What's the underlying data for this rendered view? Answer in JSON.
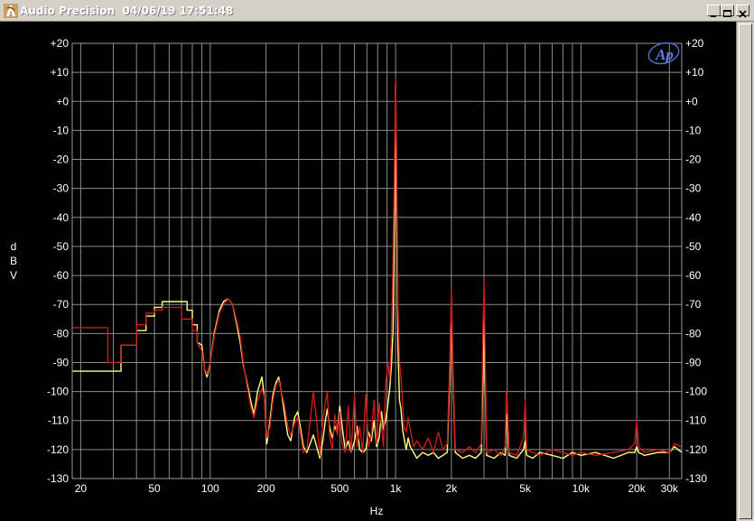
{
  "window": {
    "title": "Audio Precision  04/06/19 17:51:48",
    "icons": {
      "app": "audio-precision-icon",
      "minimize": "minimize-icon",
      "maximize": "maximize-icon",
      "close": "close-icon"
    }
  },
  "chart_data": {
    "type": "line",
    "xlabel": "Hz",
    "ylabel": "dBV",
    "xscale": "log",
    "xlim": [
      18,
      35000
    ],
    "ylim": [
      -130,
      20
    ],
    "grid": true,
    "logo_text": "Ap",
    "x_ticks": [
      {
        "v": 20,
        "label": "20"
      },
      {
        "v": 50,
        "label": "50"
      },
      {
        "v": 100,
        "label": "100"
      },
      {
        "v": 200,
        "label": "200"
      },
      {
        "v": 500,
        "label": "500"
      },
      {
        "v": 1000,
        "label": "1k"
      },
      {
        "v": 2000,
        "label": "2k"
      },
      {
        "v": 5000,
        "label": "5k"
      },
      {
        "v": 10000,
        "label": "10k"
      },
      {
        "v": 20000,
        "label": "20k"
      },
      {
        "v": 30000,
        "label": "30k"
      }
    ],
    "y_ticks": [
      {
        "v": 20,
        "label": "+20"
      },
      {
        "v": 10,
        "label": "+10"
      },
      {
        "v": 0,
        "label": "+0"
      },
      {
        "v": -10,
        "label": "-10"
      },
      {
        "v": -20,
        "label": "-20"
      },
      {
        "v": -30,
        "label": "-30"
      },
      {
        "v": -40,
        "label": "-40"
      },
      {
        "v": -50,
        "label": "-50"
      },
      {
        "v": -60,
        "label": "-60"
      },
      {
        "v": -70,
        "label": "-70"
      },
      {
        "v": -80,
        "label": "-80"
      },
      {
        "v": -90,
        "label": "-90"
      },
      {
        "v": -100,
        "label": "-100"
      },
      {
        "v": -110,
        "label": "-110"
      },
      {
        "v": -120,
        "label": "-120"
      },
      {
        "v": -130,
        "label": "-130"
      }
    ],
    "series": [
      {
        "color": "#ffff80",
        "points": [
          [
            18,
            -93
          ],
          [
            20,
            -93
          ],
          [
            25,
            -93
          ],
          [
            30,
            -93
          ],
          [
            33,
            -93
          ],
          [
            33,
            -84
          ],
          [
            40,
            -84
          ],
          [
            40,
            -79
          ],
          [
            45,
            -79
          ],
          [
            45,
            -74
          ],
          [
            50,
            -74
          ],
          [
            50,
            -71
          ],
          [
            55,
            -71
          ],
          [
            55,
            -69
          ],
          [
            60,
            -69
          ],
          [
            70,
            -69
          ],
          [
            75,
            -69
          ],
          [
            75,
            -72
          ],
          [
            80,
            -72
          ],
          [
            80,
            -77
          ],
          [
            85,
            -77
          ],
          [
            85,
            -83
          ],
          [
            90,
            -84
          ],
          [
            93,
            -92
          ],
          [
            96,
            -95
          ],
          [
            100,
            -90
          ],
          [
            105,
            -80
          ],
          [
            112,
            -72
          ],
          [
            118,
            -69
          ],
          [
            125,
            -68
          ],
          [
            132,
            -70
          ],
          [
            138,
            -76
          ],
          [
            145,
            -83
          ],
          [
            150,
            -90
          ],
          [
            158,
            -97
          ],
          [
            165,
            -103
          ],
          [
            172,
            -108
          ],
          [
            180,
            -100
          ],
          [
            190,
            -95
          ],
          [
            196,
            -102
          ],
          [
            202,
            -118
          ],
          [
            210,
            -110
          ],
          [
            218,
            -101
          ],
          [
            226,
            -97
          ],
          [
            234,
            -95
          ],
          [
            242,
            -100
          ],
          [
            252,
            -108
          ],
          [
            262,
            -115
          ],
          [
            272,
            -117
          ],
          [
            285,
            -109
          ],
          [
            296,
            -107
          ],
          [
            306,
            -112
          ],
          [
            318,
            -119
          ],
          [
            332,
            -121
          ],
          [
            346,
            -118
          ],
          [
            360,
            -115
          ],
          [
            375,
            -119
          ],
          [
            390,
            -123
          ],
          [
            405,
            -117
          ],
          [
            418,
            -110
          ],
          [
            428,
            -106
          ],
          [
            440,
            -112
          ],
          [
            455,
            -116
          ],
          [
            470,
            -112
          ],
          [
            485,
            -114
          ],
          [
            500,
            -105
          ],
          [
            515,
            -112
          ],
          [
            535,
            -120
          ],
          [
            555,
            -117
          ],
          [
            575,
            -121
          ],
          [
            600,
            -117
          ],
          [
            620,
            -112
          ],
          [
            640,
            -120
          ],
          [
            665,
            -121
          ],
          [
            690,
            -120
          ],
          [
            715,
            -114
          ],
          [
            740,
            -117
          ],
          [
            765,
            -110
          ],
          [
            790,
            -119
          ],
          [
            815,
            -116
          ],
          [
            840,
            -107
          ],
          [
            860,
            -113
          ],
          [
            885,
            -110
          ],
          [
            910,
            -104
          ],
          [
            930,
            -99
          ],
          [
            950,
            -91
          ],
          [
            970,
            -78
          ],
          [
            985,
            -40
          ],
          [
            1000,
            6
          ],
          [
            1015,
            -40
          ],
          [
            1030,
            -85
          ],
          [
            1050,
            -103
          ],
          [
            1070,
            -106
          ],
          [
            1090,
            -113
          ],
          [
            1110,
            -116
          ],
          [
            1140,
            -120
          ],
          [
            1170,
            -116
          ],
          [
            1200,
            -119
          ],
          [
            1250,
            -121
          ],
          [
            1300,
            -123
          ],
          [
            1400,
            -121
          ],
          [
            1500,
            -122
          ],
          [
            1600,
            -121
          ],
          [
            1700,
            -123
          ],
          [
            1800,
            -122
          ],
          [
            1900,
            -121
          ],
          [
            1960,
            -95
          ],
          [
            2000,
            -68
          ],
          [
            2040,
            -95
          ],
          [
            2100,
            -121
          ],
          [
            2300,
            -123
          ],
          [
            2500,
            -122
          ],
          [
            2700,
            -123
          ],
          [
            2900,
            -121
          ],
          [
            2960,
            -95
          ],
          [
            3000,
            -75
          ],
          [
            3040,
            -95
          ],
          [
            3100,
            -122
          ],
          [
            3400,
            -123
          ],
          [
            3700,
            -121
          ],
          [
            3900,
            -122
          ],
          [
            3960,
            -108
          ],
          [
            4000,
            -108
          ],
          [
            4040,
            -115
          ],
          [
            4100,
            -122
          ],
          [
            4500,
            -123
          ],
          [
            4900,
            -120
          ],
          [
            5000,
            -117
          ],
          [
            5100,
            -122
          ],
          [
            5500,
            -123
          ],
          [
            6000,
            -121
          ],
          [
            7000,
            -122
          ],
          [
            8000,
            -123
          ],
          [
            9000,
            -121
          ],
          [
            10000,
            -122
          ],
          [
            12000,
            -121
          ],
          [
            15000,
            -123
          ],
          [
            18000,
            -121
          ],
          [
            19500,
            -121
          ],
          [
            20000,
            -119
          ],
          [
            20500,
            -121
          ],
          [
            22000,
            -122
          ],
          [
            26000,
            -121
          ],
          [
            30000,
            -121
          ],
          [
            32000,
            -119
          ],
          [
            35000,
            -121
          ]
        ]
      },
      {
        "color": "#cc1a1a",
        "points": [
          [
            18,
            -78
          ],
          [
            20,
            -78
          ],
          [
            25,
            -78
          ],
          [
            28,
            -78
          ],
          [
            28,
            -90
          ],
          [
            33,
            -90
          ],
          [
            33,
            -84
          ],
          [
            40,
            -84
          ],
          [
            40,
            -77
          ],
          [
            45,
            -77
          ],
          [
            45,
            -73
          ],
          [
            50,
            -73
          ],
          [
            50,
            -72
          ],
          [
            55,
            -72
          ],
          [
            55,
            -71
          ],
          [
            60,
            -71
          ],
          [
            70,
            -71
          ],
          [
            70,
            -75
          ],
          [
            80,
            -75
          ],
          [
            80,
            -79
          ],
          [
            85,
            -79
          ],
          [
            85,
            -83
          ],
          [
            90,
            -86
          ],
          [
            93,
            -92
          ],
          [
            96,
            -94
          ],
          [
            100,
            -90
          ],
          [
            105,
            -81
          ],
          [
            112,
            -73
          ],
          [
            118,
            -70
          ],
          [
            125,
            -68
          ],
          [
            132,
            -70
          ],
          [
            138,
            -75
          ],
          [
            145,
            -81
          ],
          [
            150,
            -89
          ],
          [
            158,
            -98
          ],
          [
            165,
            -105
          ],
          [
            172,
            -109
          ],
          [
            180,
            -103
          ],
          [
            190,
            -99
          ],
          [
            196,
            -102
          ],
          [
            202,
            -116
          ],
          [
            210,
            -112
          ],
          [
            218,
            -103
          ],
          [
            226,
            -98
          ],
          [
            234,
            -96
          ],
          [
            242,
            -100
          ],
          [
            252,
            -105
          ],
          [
            262,
            -112
          ],
          [
            272,
            -115
          ],
          [
            285,
            -111
          ],
          [
            296,
            -109
          ],
          [
            306,
            -114
          ],
          [
            318,
            -121
          ],
          [
            332,
            -120
          ],
          [
            346,
            -110
          ],
          [
            360,
            -100
          ],
          [
            375,
            -110
          ],
          [
            390,
            -122
          ],
          [
            405,
            -110
          ],
          [
            418,
            -104
          ],
          [
            428,
            -100
          ],
          [
            440,
            -115
          ],
          [
            455,
            -120
          ],
          [
            470,
            -108
          ],
          [
            485,
            -115
          ],
          [
            500,
            -107
          ],
          [
            515,
            -118
          ],
          [
            535,
            -121
          ],
          [
            555,
            -105
          ],
          [
            575,
            -121
          ],
          [
            600,
            -101
          ],
          [
            620,
            -119
          ],
          [
            640,
            -112
          ],
          [
            665,
            -121
          ],
          [
            690,
            -101
          ],
          [
            715,
            -119
          ],
          [
            740,
            -115
          ],
          [
            765,
            -103
          ],
          [
            790,
            -118
          ],
          [
            815,
            -104
          ],
          [
            840,
            -112
          ],
          [
            860,
            -119
          ],
          [
            885,
            -97
          ],
          [
            910,
            -90
          ],
          [
            930,
            -96
          ],
          [
            950,
            -80
          ],
          [
            965,
            -60
          ],
          [
            985,
            -25
          ],
          [
            1000,
            8
          ],
          [
            1015,
            -25
          ],
          [
            1030,
            -70
          ],
          [
            1050,
            -90
          ],
          [
            1070,
            -95
          ],
          [
            1090,
            -104
          ],
          [
            1110,
            -112
          ],
          [
            1140,
            -114
          ],
          [
            1170,
            -109
          ],
          [
            1200,
            -113
          ],
          [
            1250,
            -119
          ],
          [
            1300,
            -117
          ],
          [
            1400,
            -120
          ],
          [
            1500,
            -116
          ],
          [
            1600,
            -121
          ],
          [
            1700,
            -114
          ],
          [
            1800,
            -120
          ],
          [
            1900,
            -118
          ],
          [
            1960,
            -90
          ],
          [
            2000,
            -65
          ],
          [
            2040,
            -92
          ],
          [
            2100,
            -120
          ],
          [
            2300,
            -121
          ],
          [
            2500,
            -119
          ],
          [
            2700,
            -121
          ],
          [
            2900,
            -118
          ],
          [
            2960,
            -80
          ],
          [
            3000,
            -62
          ],
          [
            3040,
            -85
          ],
          [
            3100,
            -121
          ],
          [
            3400,
            -120
          ],
          [
            3700,
            -122
          ],
          [
            3900,
            -119
          ],
          [
            3960,
            -100
          ],
          [
            4000,
            -103
          ],
          [
            4040,
            -110
          ],
          [
            4100,
            -121
          ],
          [
            4500,
            -122
          ],
          [
            4900,
            -116
          ],
          [
            5000,
            -103
          ],
          [
            5100,
            -120
          ],
          [
            5500,
            -121
          ],
          [
            6000,
            -122
          ],
          [
            7000,
            -120
          ],
          [
            8000,
            -121
          ],
          [
            9000,
            -122
          ],
          [
            10000,
            -121
          ],
          [
            12000,
            -122
          ],
          [
            15000,
            -121
          ],
          [
            18000,
            -120
          ],
          [
            19500,
            -118
          ],
          [
            20000,
            -110
          ],
          [
            20500,
            -119
          ],
          [
            22000,
            -121
          ],
          [
            26000,
            -120
          ],
          [
            30000,
            -121
          ],
          [
            32000,
            -118
          ],
          [
            35000,
            -119
          ]
        ]
      }
    ]
  }
}
